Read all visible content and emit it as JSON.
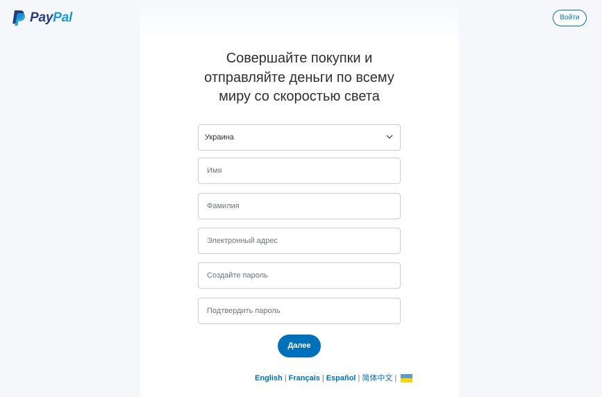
{
  "header": {
    "logo": {
      "brand_part1": "Pay",
      "brand_part2": "Pal",
      "icon": "paypal-logo-icon"
    },
    "login_label": "Войти"
  },
  "signup": {
    "headline_lines": [
      "Совершайте покупки и",
      "отправляйте деньги по всему",
      "миру со скоростью света"
    ],
    "country": {
      "value": "Украина",
      "icon": "chevron-down-icon"
    },
    "fields": {
      "first_name": {
        "placeholder": "Имя",
        "value": ""
      },
      "last_name": {
        "placeholder": "Фамилия",
        "value": ""
      },
      "email": {
        "placeholder": "Электронный адрес",
        "value": ""
      },
      "password": {
        "placeholder": "Создайте пароль",
        "value": ""
      },
      "confirm_password": {
        "placeholder": "Подтвердить пароль",
        "value": ""
      }
    },
    "next_label": "Далее"
  },
  "footer": {
    "languages": [
      "English",
      "Français",
      "Español",
      "简体中文"
    ],
    "separator": "|",
    "flag_icon": "ukraine-flag-icon"
  },
  "colors": {
    "brand_blue": "#0070ba",
    "logo_dark_blue": "#253b80",
    "logo_light_blue": "#179bd7",
    "page_background": "#f5f7fa",
    "field_border": "#c9cdd1"
  }
}
